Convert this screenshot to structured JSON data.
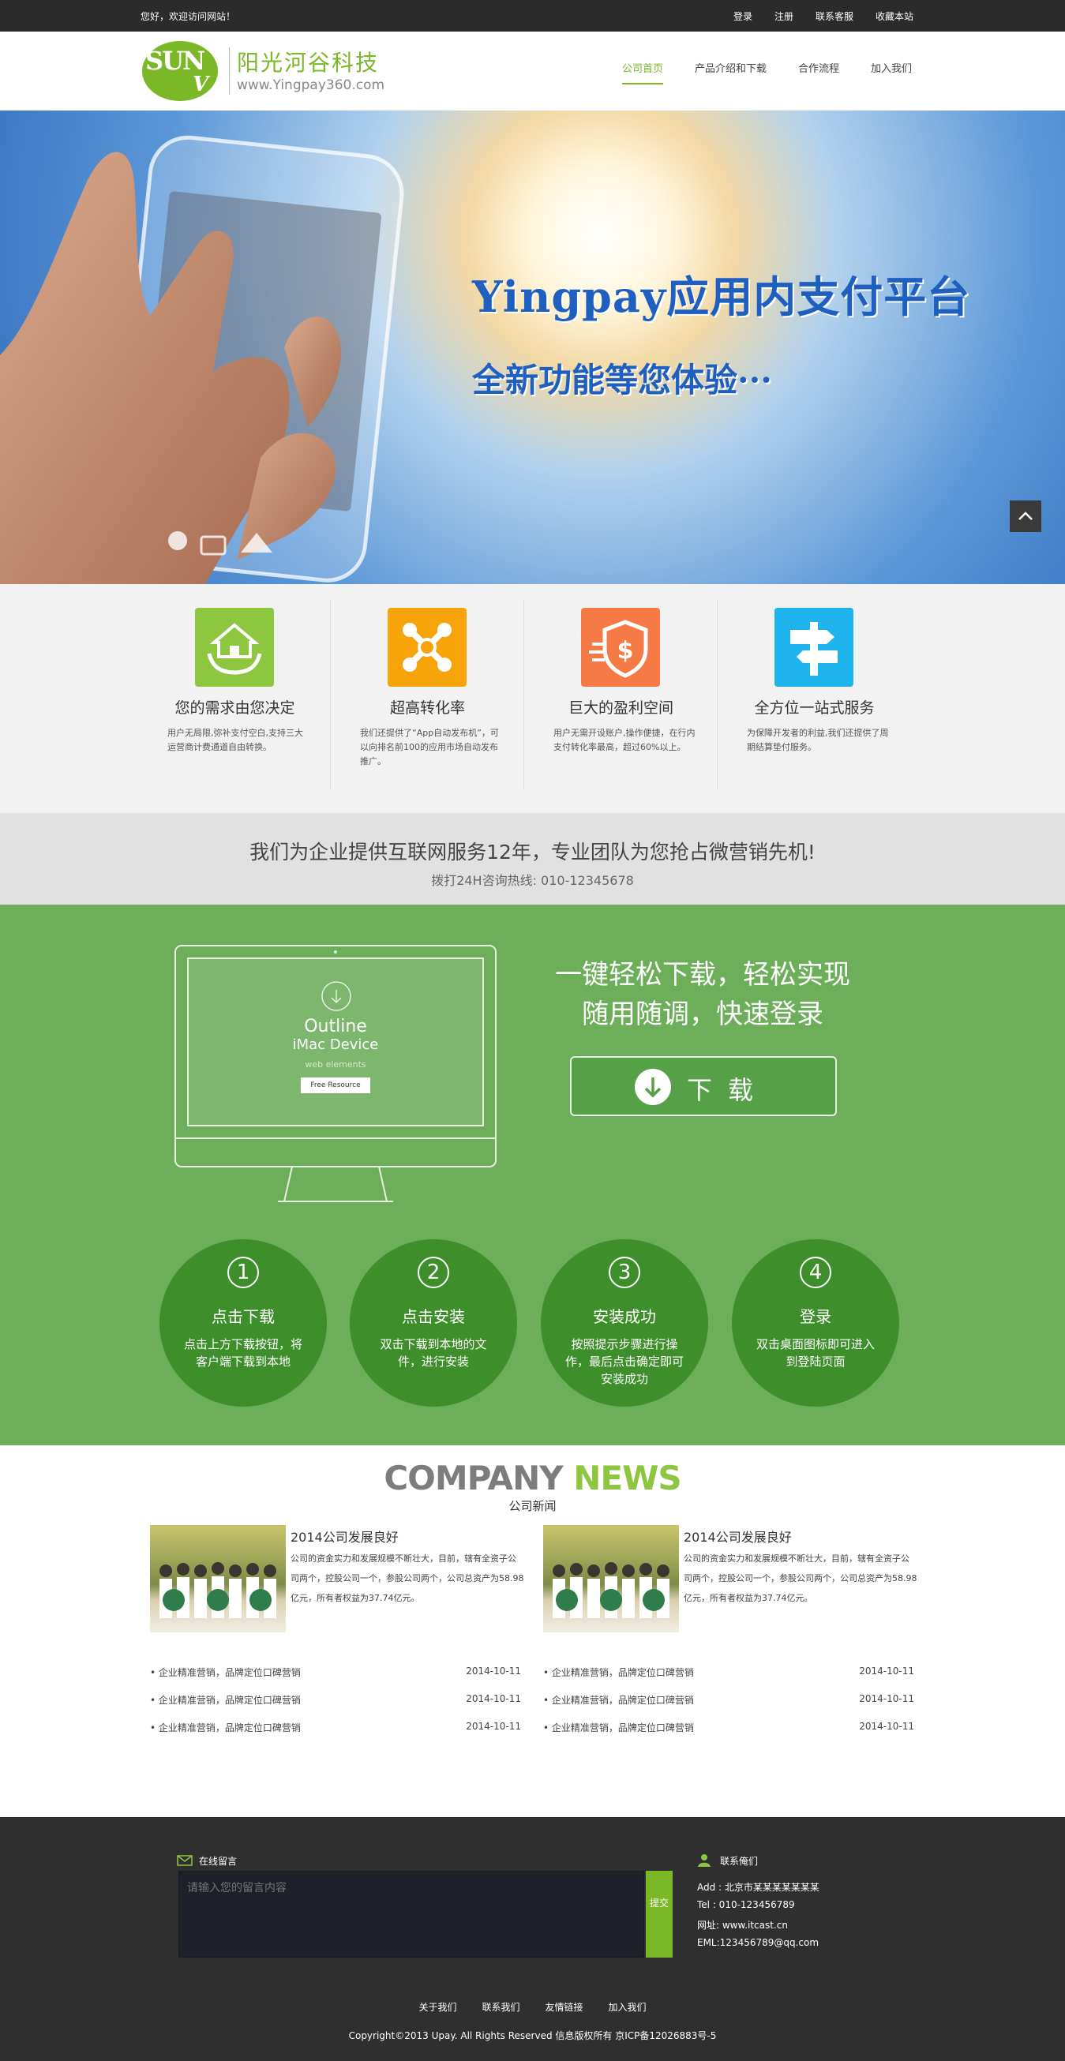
{
  "topbar": {
    "welcome": "您好，欢迎访问网站！",
    "links": [
      "登录",
      "注册",
      "联系客服",
      "收藏本站"
    ]
  },
  "header": {
    "logo_mark": "SUN",
    "logo_mark_v": "V",
    "logo_title": "阳光河谷科技",
    "logo_url": "www.Yingpay360.com",
    "nav": [
      "公司首页",
      "产品介绍和下载",
      "合作流程",
      "加入我们"
    ],
    "nav_active": 0,
    "accent": "#7ab827"
  },
  "banner": {
    "title1": "Yingpay应用内支付平台",
    "title2": "全新功能等您体验···"
  },
  "features": [
    {
      "icon": "home-hands-icon",
      "color": "#8dc63f",
      "title": "您的需求由您决定",
      "desc": "用户无局限,弥补支付空白,支持三大运营商计费通道自由转换。"
    },
    {
      "icon": "network-icon",
      "color": "#f7a30a",
      "title": "超高转化率",
      "desc": "我们还提供了“App自动发布机”，可以向排名前100的应用市场自动发布推广。"
    },
    {
      "icon": "shield-dollar-icon",
      "color": "#f57a45",
      "title": "巨大的盈利空间",
      "desc": "用户无需开设账户,操作便捷，在行内支付转化率最高，超过60%以上。"
    },
    {
      "icon": "signpost-icon",
      "color": "#1fb4ee",
      "title": "全方位一站式服务",
      "desc": "为保障开发者的利益,我们还提供了周期结算垫付服务。"
    }
  ],
  "strip": {
    "headline": "我们为企业提供互联网服务12年，专业团队为您抢占微营销先机!",
    "hotline": "拨打24H咨询热线: 010-12345678"
  },
  "download": {
    "device_title": "Outline",
    "device_sub": "iMac Device",
    "device_small": "web elements",
    "device_button": "Free Resource",
    "line1": "一键轻松下载，轻松实现",
    "line2": "随用随调，快速登录",
    "button": "下载",
    "steps": [
      {
        "num": "1",
        "title": "点击下载",
        "desc": "点击上方下载按钮，将客户端下载到本地"
      },
      {
        "num": "2",
        "title": "点击安装",
        "desc": "双击下载到本地的文件，进行安装"
      },
      {
        "num": "3",
        "title": "安装成功",
        "desc": "按照提示步骤进行操作，最后点击确定即可安装成功"
      },
      {
        "num": "4",
        "title": "登录",
        "desc": "双击桌面图标即可进入到登陆页面"
      }
    ]
  },
  "news": {
    "heading_a": "COMPANY",
    "heading_b": "NEWS",
    "subheading": "公司新闻",
    "cards": [
      {
        "title": "2014公司发展良好",
        "desc": "公司的资金实力和发展规模不断壮大，目前，辖有全资子公司两个，控股公司一个，参股公司两个，公司总资产为58.98亿元，所有者权益为37.74亿元。"
      },
      {
        "title": "2014公司发展良好",
        "desc": "公司的资金实力和发展规模不断壮大，目前，辖有全资子公司两个，控股公司一个，参股公司两个，公司总资产为58.98亿元，所有者权益为37.74亿元。"
      }
    ],
    "lists": [
      [
        {
          "text": "• 企业精准营销，品牌定位口碑营销",
          "date": "2014-10-11"
        },
        {
          "text": "• 企业精准营销，品牌定位口碑营销",
          "date": "2014-10-11"
        },
        {
          "text": "• 企业精准营销，品牌定位口碑营销",
          "date": "2014-10-11"
        }
      ],
      [
        {
          "text": "• 企业精准营销，品牌定位口碑营销",
          "date": "2014-10-11"
        },
        {
          "text": "• 企业精准营销，品牌定位口碑营销",
          "date": "2014-10-11"
        },
        {
          "text": "• 企业精准营销，品牌定位口碑营销",
          "date": "2014-10-11"
        }
      ]
    ]
  },
  "footer": {
    "message_label": "在线留言",
    "message_placeholder": "请输入您的留言内容",
    "submit": "提交",
    "contact_label": "联系俺们",
    "contacts": [
      "Add : 北京市某某某某某某某",
      "Tel : 010-123456789",
      "网址: www.itcast.cn",
      "EML:123456789@qq.com"
    ],
    "nav": [
      "关于我们",
      "联系我们",
      "友情链接",
      "加入我们"
    ],
    "copyright": "Copyright©2013 Upay. All Rights Reserved 信息版权所有 京ICP备12026883号-5"
  }
}
